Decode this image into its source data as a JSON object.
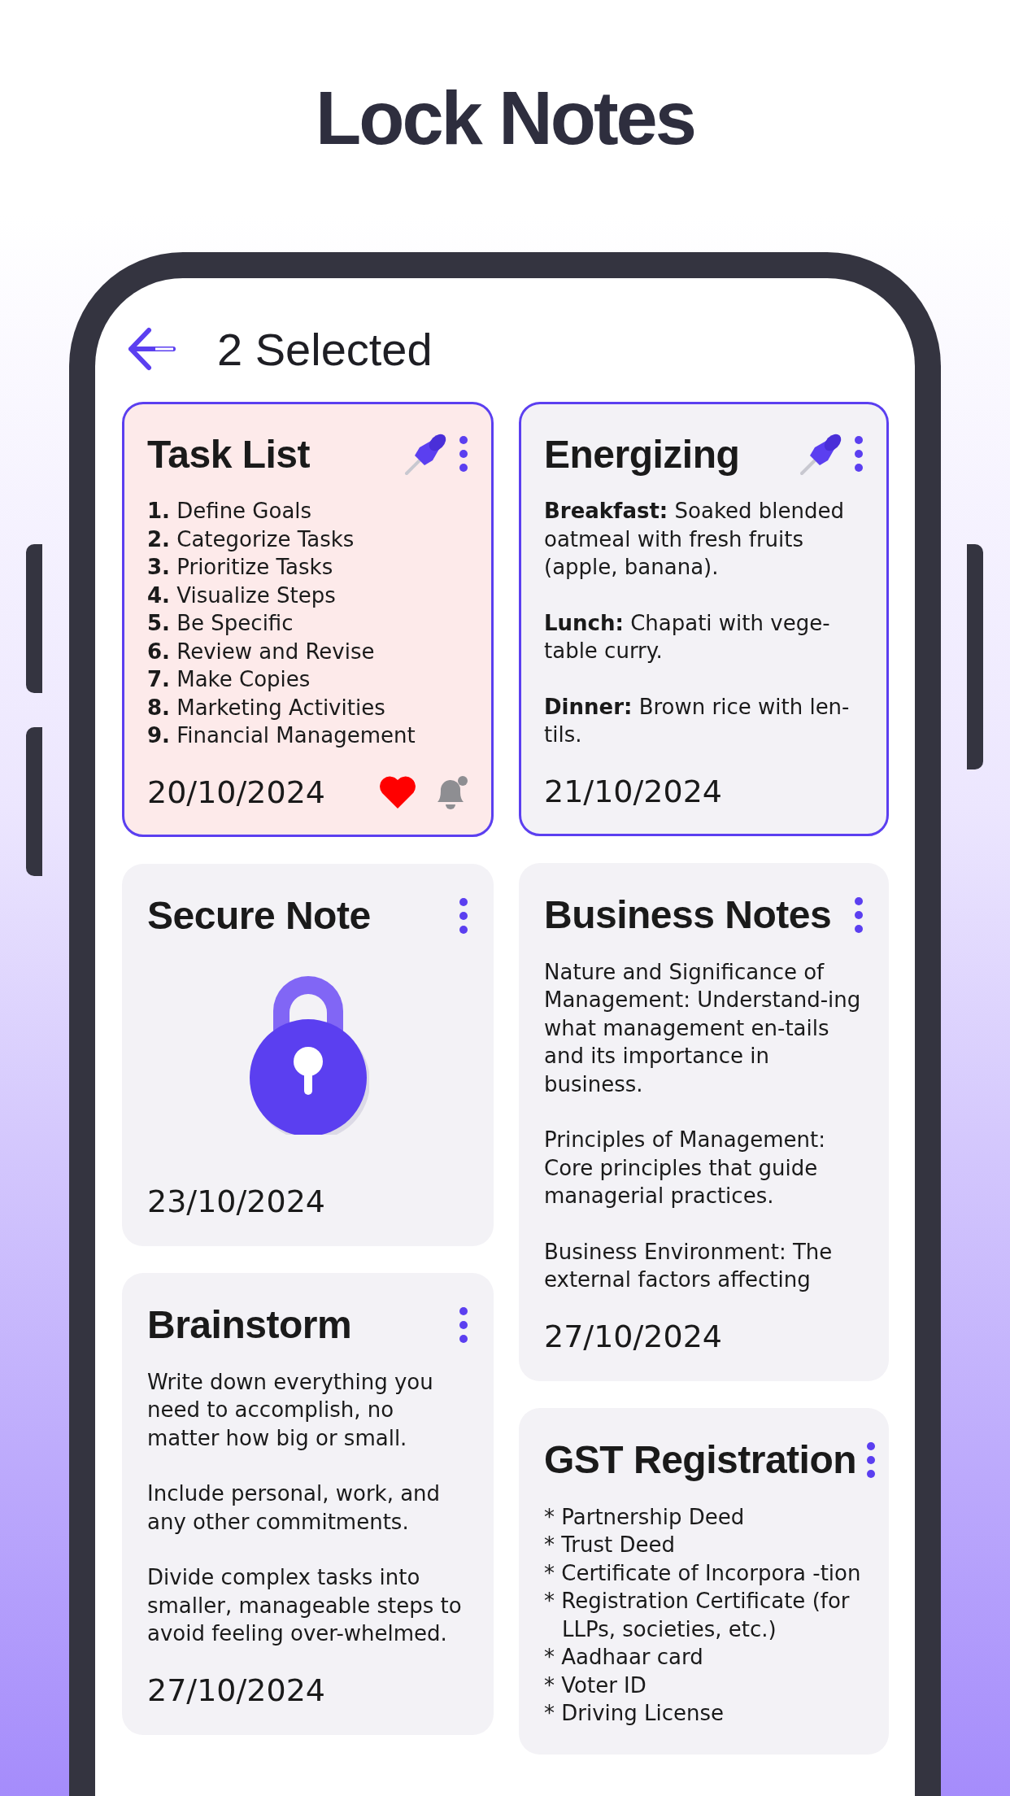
{
  "headline": "Lock Notes",
  "app_bar": {
    "title": "2 Selected"
  },
  "columns": [
    {
      "notes": [
        {
          "kind": "list",
          "title": "Task List",
          "selected": true,
          "color": "#fdeaea",
          "pinned": true,
          "favorite": true,
          "reminder": true,
          "date": "20/10/2024",
          "lines": [
            "**1.** Define Goals",
            "**2.** Categorize Tasks",
            "**3.** Prioritize Tasks",
            "**4.** Visualize Steps",
            "**5.** Be Specific",
            "**6.** Review and Revise",
            "**7.** Make Copies",
            "**8.** Marketing Activities",
            "**9.** Financial Management"
          ]
        },
        {
          "kind": "locked",
          "title": "Secure Note",
          "selected": false,
          "color": "#f3f2f6",
          "pinned": false,
          "favorite": false,
          "reminder": false,
          "date": "23/10/2024"
        },
        {
          "kind": "text",
          "title": "Brainstorm",
          "selected": false,
          "color": "#f3f2f6",
          "pinned": false,
          "favorite": false,
          "reminder": false,
          "date": "27/10/2024",
          "lines": [
            "Write down everything you need to accomplish, no matter how big or small.",
            "Include personal, work, and any other commitments.",
            "Divide complex tasks into smaller, manageable steps to avoid feeling over-whelmed."
          ]
        }
      ]
    },
    {
      "notes": [
        {
          "kind": "text",
          "title": "Energizing",
          "selected": true,
          "color": "#f3f2f6",
          "pinned": true,
          "favorite": false,
          "reminder": false,
          "date": "21/10/2024",
          "lines": [
            "**Breakfast:** Soaked blended oatmeal with fresh fruits (apple, banana).",
            "**Lunch:** Chapati with vege-table curry.",
            "**Dinner:** Brown rice with len-tils."
          ]
        },
        {
          "kind": "text",
          "title": "Business Notes",
          "selected": false,
          "color": "#f3f2f6",
          "pinned": false,
          "favorite": false,
          "reminder": false,
          "date": "27/10/2024",
          "lines": [
            "Nature and Significance of Management: Understand-ing what management en-tails and its importance in business.",
            "Principles of Management: Core principles that guide managerial practices.",
            "Business Environment: The external factors affecting"
          ]
        },
        {
          "kind": "bullets",
          "title": "GST Registration",
          "selected": false,
          "color": "#f3f2f6",
          "pinned": false,
          "favorite": false,
          "reminder": false,
          "lines": [
            "* Partnership Deed",
            "* Trust Deed",
            "* Certificate of Incorpora -tion",
            "* Registration Certificate (for LLPs, societies, etc.)",
            "* Aadhaar card",
            "* Voter ID",
            "* Driving License"
          ]
        }
      ]
    }
  ]
}
